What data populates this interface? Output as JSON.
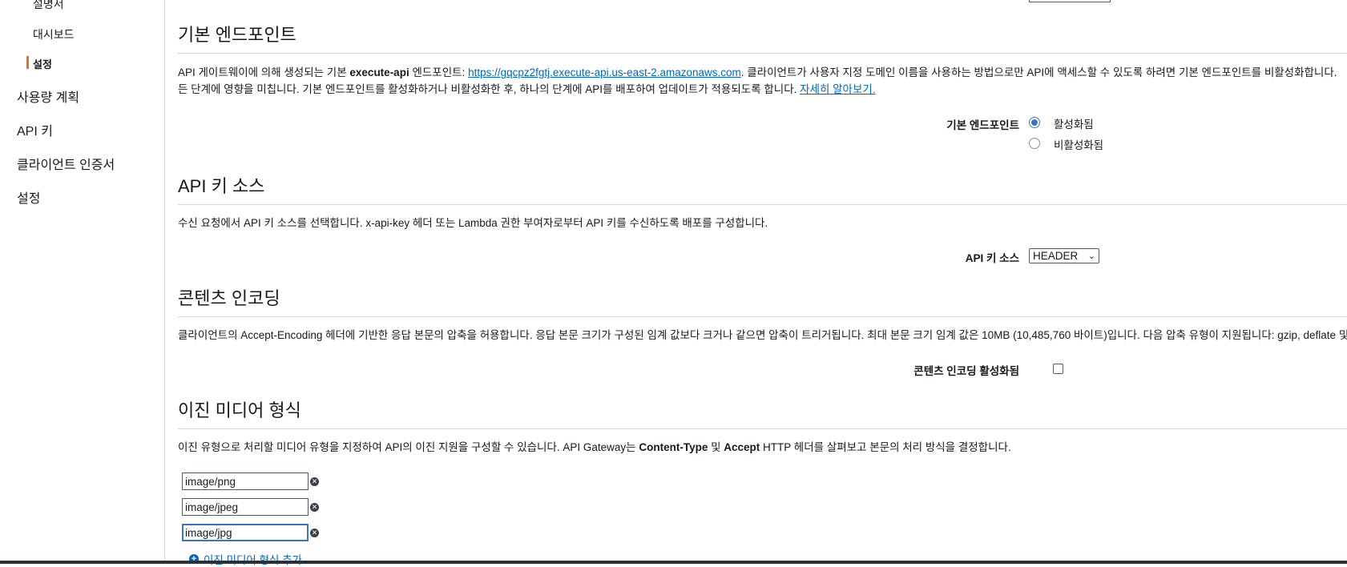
{
  "sidebar": {
    "sub_items": [
      {
        "label": "설명서"
      },
      {
        "label": "대시보드"
      },
      {
        "label": "설정"
      }
    ],
    "items": [
      {
        "label": "사용량 계획"
      },
      {
        "label": "API 키"
      },
      {
        "label": "클라이언트 인증서"
      },
      {
        "label": "설정"
      }
    ]
  },
  "default_endpoint": {
    "title": "기본 엔드포인트",
    "desc_prefix": "API 게이트웨이에 의해 생성되는 기본 ",
    "desc_bold": "execute-api",
    "desc_mid": " 엔드포인트: ",
    "desc_url": "https://gqcpz2fgtj.execute-api.us-east-2.amazonaws.com",
    "desc_suffix": ". 클라이언트가 사용자 지정 도메인 이름을 사용하는 방법으로만 API에 액세스할 수 있도록 하려면 기본 엔드포인트를 비활성화합니다.",
    "desc_line2": "든 단계에 영향을 미칩니다. 기본 엔드포인트를 활성화하거나 비활성화한 후, 하나의 단계에 API를 배포하여 업데이트가 적용되도록 합니다. ",
    "learn_more": "자세히 알아보기.",
    "field_label": "기본 엔드포인트",
    "options": [
      {
        "label": "활성화됨",
        "checked": true
      },
      {
        "label": "비활성화됨",
        "checked": false
      }
    ]
  },
  "api_key_source": {
    "title": "API 키 소스",
    "desc": "수신 요청에서 API 키 소스를 선택합니다. x-api-key 헤더 또는 Lambda 권한 부여자로부터 API 키를 수신하도록 배포를 구성합니다.",
    "field_label": "API 키 소스",
    "selected": "HEADER"
  },
  "content_encoding": {
    "title": "콘텐츠 인코딩",
    "desc": "클라이언트의 Accept-Encoding 헤더에 기반한 응답 본문의 압축을 허용합니다. 응답 본문 크기가 구성된 임계 값보다 크거나 같으면 압축이 트리거됩니다. 최대 본문 크기 임계 값은 10MB (10,485,760 바이트)입니다. 다음 압축 유형이 지원됩니다: gzip, deflate 및 i",
    "field_label": "콘텐츠 인코딩 활성화됨",
    "enabled": false
  },
  "binary_media": {
    "title": "이진 미디어 형식",
    "desc_prefix": "이진 유형으로 처리할 미디어 유형을 지정하여 API의 이진 지원을 구성할 수 있습니다. API Gateway는 ",
    "desc_bold1": "Content-Type",
    "desc_mid": " 및 ",
    "desc_bold2": "Accept",
    "desc_suffix": " HTTP 헤더를 살펴보고 본문의 처리 방식을 결정합니다.",
    "types": [
      "image/png",
      "image/jpeg",
      "image/jpg"
    ],
    "add_label": "이진 미디어 형식 추가"
  }
}
